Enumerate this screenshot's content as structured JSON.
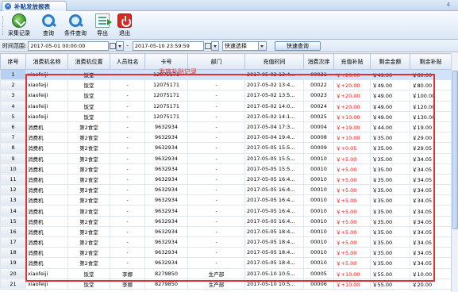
{
  "tab": {
    "close_icon": "close-icon",
    "title": "补贴发放报表",
    "tab_count": "4"
  },
  "toolbar": {
    "buttons": [
      {
        "label": "采集记录",
        "icon": "collect-icon"
      },
      {
        "label": "查询",
        "icon": "search-icon"
      },
      {
        "label": "条件查询",
        "icon": "filter-search-icon"
      },
      {
        "label": "导出",
        "icon": "export-icon"
      },
      {
        "label": "退出",
        "icon": "exit-icon"
      }
    ]
  },
  "filter": {
    "label": "时间范围:",
    "start": "2017-05-01 00:00:00",
    "sep": "-",
    "end": "2017-05-10 23:59:59",
    "quick_select": "快速选择",
    "quick_query": "快速查询"
  },
  "table": {
    "columns": [
      "序号",
      "消费机名称",
      "消费机位置",
      "人员姓名",
      "卡号",
      "部门",
      "充值时间",
      "消费次序",
      "充值补贴",
      "剩余金额",
      "剩余补贴"
    ],
    "rows": [
      [
        "1",
        "xiaofeiji",
        "饭堂",
        "-",
        "12075171",
        "-",
        "2017-05-02 13:4...",
        "00021",
        "￥+20.00",
        "￥49.00",
        "￥60.00"
      ],
      [
        "2",
        "xiaofeiji",
        "饭堂",
        "-",
        "12075171",
        "-",
        "2017-05-02 13:4...",
        "00022",
        "￥+20.00",
        "￥49.00",
        "￥80.00"
      ],
      [
        "3",
        "xiaofeiji",
        "饭堂",
        "-",
        "12075171",
        "-",
        "2017-05-02 13:5...",
        "00023",
        "￥+20.00",
        "￥49.00",
        "￥100.00"
      ],
      [
        "4",
        "xiaofeiji",
        "饭堂",
        "-",
        "12075171",
        "-",
        "2017-05-02 14:0...",
        "00024",
        "￥+20.00",
        "￥49.00",
        "￥120.00"
      ],
      [
        "5",
        "xiaofeiji",
        "饭堂",
        "-",
        "12075171",
        "-",
        "2017-05-02 14:1...",
        "00025",
        "￥+10.00",
        "￥49.00",
        "￥130.00"
      ],
      [
        "6",
        "消费机",
        "第2食堂",
        "-",
        "9632934",
        "-",
        "2017-05-04 17:3...",
        "00004",
        "￥+19.00",
        "￥44.00",
        "￥19.00"
      ],
      [
        "7",
        "消费机",
        "第2食堂",
        "-",
        "9632934",
        "-",
        "2017-05-04 19:4...",
        "00008",
        "￥+10.00",
        "￥35.00",
        "￥29.00"
      ],
      [
        "8",
        "消费机",
        "第2食堂",
        "-",
        "9632934",
        "-",
        "2017-05-05 15:5...",
        "00009",
        "￥+0.05",
        "￥35.00",
        "￥29.05"
      ],
      [
        "9",
        "消费机",
        "第2食堂",
        "-",
        "9632934",
        "-",
        "2017-05-05 15:5...",
        "00010",
        "￥+5.00",
        "￥35.00",
        "￥34.05"
      ],
      [
        "10",
        "消费机",
        "第2食堂",
        "-",
        "9632934",
        "-",
        "2017-05-05 15:5...",
        "00010",
        "￥+5.00",
        "￥35.00",
        "￥34.05"
      ],
      [
        "11",
        "消费机",
        "第2食堂",
        "-",
        "9632934",
        "-",
        "2017-05-05 16:4...",
        "00010",
        "￥+5.00",
        "￥35.00",
        "￥34.05"
      ],
      [
        "12",
        "消费机",
        "第2食堂",
        "-",
        "9632934",
        "-",
        "2017-05-05 16:4...",
        "00010",
        "￥+5.00",
        "￥35.00",
        "￥34.05"
      ],
      [
        "13",
        "消费机",
        "第2食堂",
        "-",
        "9632934",
        "-",
        "2017-05-05 16:4...",
        "00010",
        "￥+5.00",
        "￥35.00",
        "￥34.05"
      ],
      [
        "14",
        "消费机",
        "第2食堂",
        "-",
        "9632934",
        "-",
        "2017-05-05 16:4...",
        "00010",
        "￥+5.00",
        "￥35.00",
        "￥34.05"
      ],
      [
        "15",
        "消费机",
        "第2食堂",
        "-",
        "9632934",
        "-",
        "2017-05-05 16:4...",
        "00010",
        "￥+5.00",
        "￥35.00",
        "￥34.05"
      ],
      [
        "16",
        "消费机",
        "第2食堂",
        "-",
        "9632934",
        "-",
        "2017-05-05 18:4...",
        "00010",
        "￥+5.00",
        "￥35.00",
        "￥34.05"
      ],
      [
        "17",
        "消费机",
        "第2食堂",
        "-",
        "9632934",
        "-",
        "2017-05-05 18:4...",
        "00010",
        "￥+5.00",
        "￥35.00",
        "￥34.05"
      ],
      [
        "18",
        "消费机",
        "第2食堂",
        "-",
        "9632934",
        "-",
        "2017-05-05 18:4...",
        "00010",
        "￥+5.00",
        "￥35.00",
        "￥34.05"
      ],
      [
        "19",
        "消费机",
        "第2食堂",
        "-",
        "9632934",
        "-",
        "2017-05-05 18:4...",
        "00010",
        "￥+5.00",
        "￥35.00",
        "￥34.05"
      ],
      [
        "20",
        "xiaofeiji",
        "饭堂",
        "李娜",
        "8279850",
        "生产部",
        "2017-05-10 10:5...",
        "00005",
        "￥+10.00",
        "￥55.00",
        "￥10.00"
      ],
      [
        "21",
        "xiaofeiji",
        "饭堂",
        "李娜",
        "8279850",
        "生产部",
        "2017-05-10 10:5...",
        "00006",
        "￥+10.00",
        "￥55.00",
        "￥20.00"
      ]
    ]
  },
  "annotation": "发放补贴记录",
  "colors": {
    "red": "#e02020",
    "selected_row": "#cfe3fb",
    "header_blue": "#15428b"
  }
}
